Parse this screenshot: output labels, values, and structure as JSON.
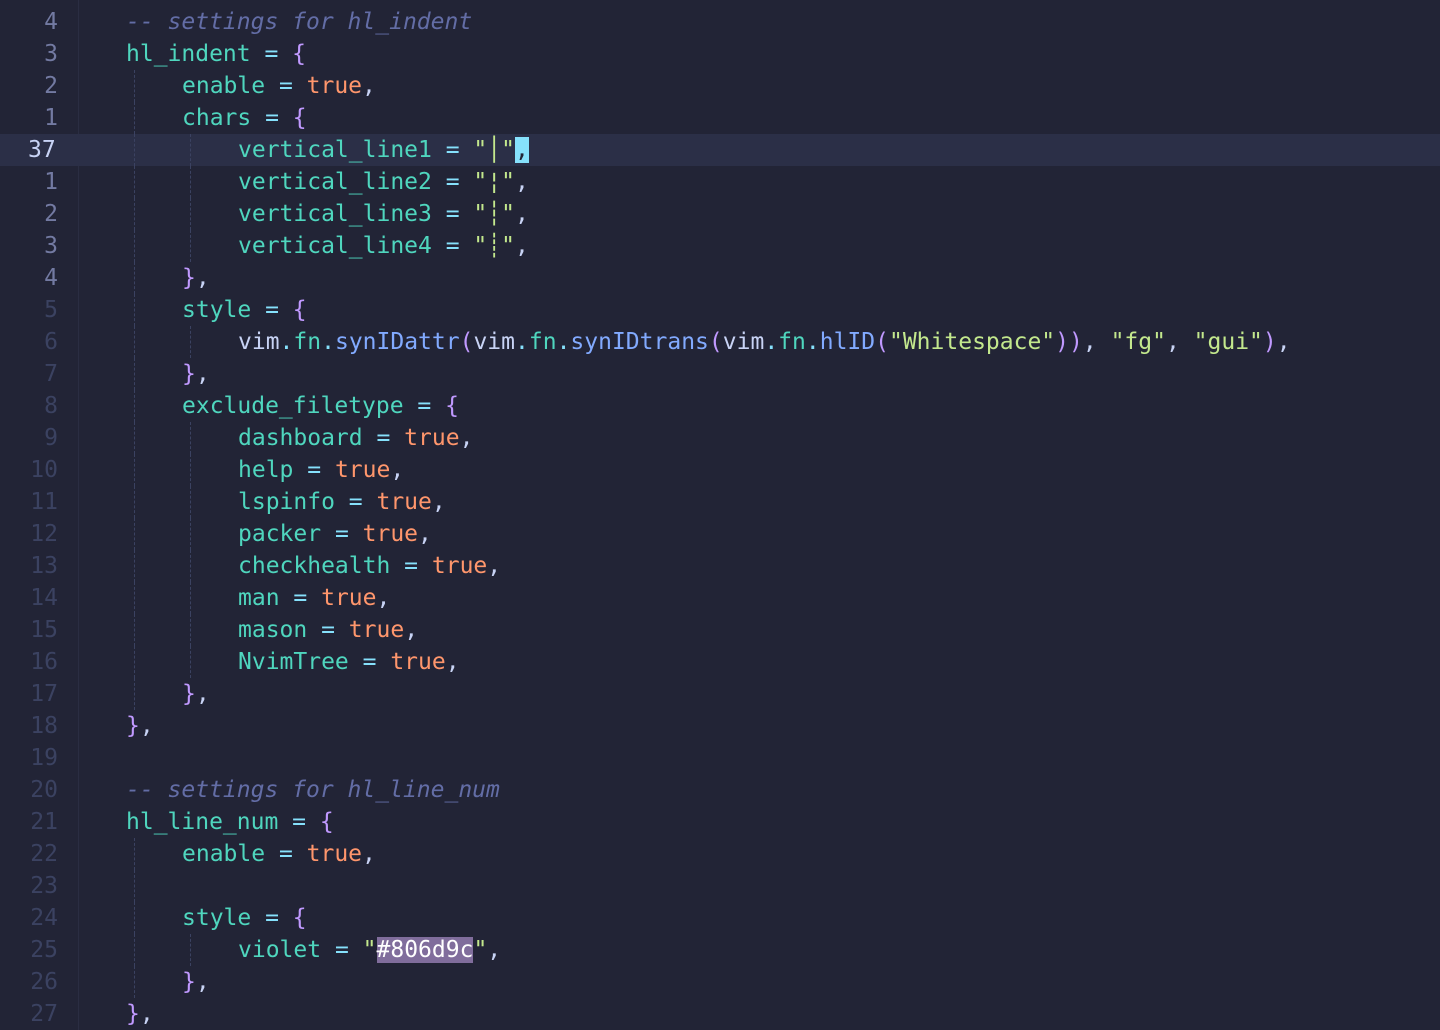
{
  "editor": {
    "colors": {
      "background": "#222436",
      "cursorline": "#2b2f47",
      "identifier": "#4fd6be",
      "operator": "#86e1fc",
      "brace": "#c099ff",
      "boolean": "#ff966c",
      "string": "#c3e88d",
      "function": "#82aaff",
      "comment": "#636da6",
      "violet_highlight": "#806d9c"
    },
    "current_line_number": "37",
    "lines": [
      {
        "ln": "4",
        "comment": "-- settings for hl_indent"
      },
      {
        "ln": "3",
        "key": "hl_indent",
        "eq": " = ",
        "brace": "{"
      },
      {
        "ln": "2",
        "key": "enable",
        "eq": " = ",
        "value": "true",
        "punct": ","
      },
      {
        "ln": "1",
        "key": "chars",
        "eq": " = ",
        "brace": "{"
      },
      {
        "ln": "37",
        "key": "vertical_line1",
        "eq": " = ",
        "q1": "\"",
        "char": "│",
        "q2": "\"",
        "punct": ","
      },
      {
        "ln": "1",
        "key": "vertical_line2",
        "eq": " = ",
        "q1": "\"",
        "char": "¦",
        "q2": "\"",
        "punct": ","
      },
      {
        "ln": "2",
        "key": "vertical_line3",
        "eq": " = ",
        "q1": "\"",
        "char": "┆",
        "q2": "\"",
        "punct": ","
      },
      {
        "ln": "3",
        "key": "vertical_line4",
        "eq": " = ",
        "q1": "\"",
        "char": "┊",
        "q2": "\"",
        "punct": ","
      },
      {
        "ln": "4",
        "close": "}",
        "punct": ","
      },
      {
        "ln": "5",
        "key": "style",
        "eq": " = ",
        "brace": "{"
      },
      {
        "ln": "6",
        "style_expr": {
          "a": "vim",
          "b": ".",
          "c": "fn",
          "d": ".",
          "f1": "synIDattr",
          "p1": "(",
          "e": "vim",
          "g": ".",
          "h": "fn",
          "i": ".",
          "f2": "synIDtrans",
          "p2": "(",
          "j": "vim",
          "k": ".",
          "l": "fn",
          "m": ".",
          "f3": "hlID",
          "p3": "(",
          "s1": "\"Whitespace\"",
          "p4": "))",
          "c1": ", ",
          "s2": "\"fg\"",
          "c2": ", ",
          "s3": "\"gui\"",
          "p5": ")",
          "c3": ","
        }
      },
      {
        "ln": "7",
        "close": "}",
        "punct": ","
      },
      {
        "ln": "8",
        "key": "exclude_filetype",
        "eq": " = ",
        "brace": "{"
      },
      {
        "ln": "9",
        "key": "dashboard",
        "eq": " = ",
        "value": "true",
        "punct": ","
      },
      {
        "ln": "10",
        "key": "help",
        "eq": " = ",
        "value": "true",
        "punct": ","
      },
      {
        "ln": "11",
        "key": "lspinfo",
        "eq": " = ",
        "value": "true",
        "punct": ","
      },
      {
        "ln": "12",
        "key": "packer",
        "eq": " = ",
        "value": "true",
        "punct": ","
      },
      {
        "ln": "13",
        "key": "checkhealth",
        "eq": " = ",
        "value": "true",
        "punct": ","
      },
      {
        "ln": "14",
        "key": "man",
        "eq": " = ",
        "value": "true",
        "punct": ","
      },
      {
        "ln": "15",
        "key": "mason",
        "eq": " = ",
        "value": "true",
        "punct": ","
      },
      {
        "ln": "16",
        "key": "NvimTree",
        "eq": " = ",
        "value": "true",
        "punct": ","
      },
      {
        "ln": "17",
        "close": "}",
        "punct": ","
      },
      {
        "ln": "18",
        "close": "}",
        "punct": ","
      },
      {
        "ln": "19"
      },
      {
        "ln": "20",
        "comment": "-- settings for hl_line_num"
      },
      {
        "ln": "21",
        "key": "hl_line_num",
        "eq": " = ",
        "brace": "{"
      },
      {
        "ln": "22",
        "key": "enable",
        "eq": " = ",
        "value": "true",
        "punct": ","
      },
      {
        "ln": "23"
      },
      {
        "ln": "24",
        "key": "style",
        "eq": " = ",
        "brace": "{"
      },
      {
        "ln": "25",
        "key": "violet",
        "eq": " = ",
        "q1": "\"",
        "hexval": "#806d9c",
        "q2": "\"",
        "punct": ","
      },
      {
        "ln": "26",
        "close": "}",
        "punct": ","
      },
      {
        "ln": "27",
        "close": "}",
        "punct": ","
      }
    ]
  }
}
